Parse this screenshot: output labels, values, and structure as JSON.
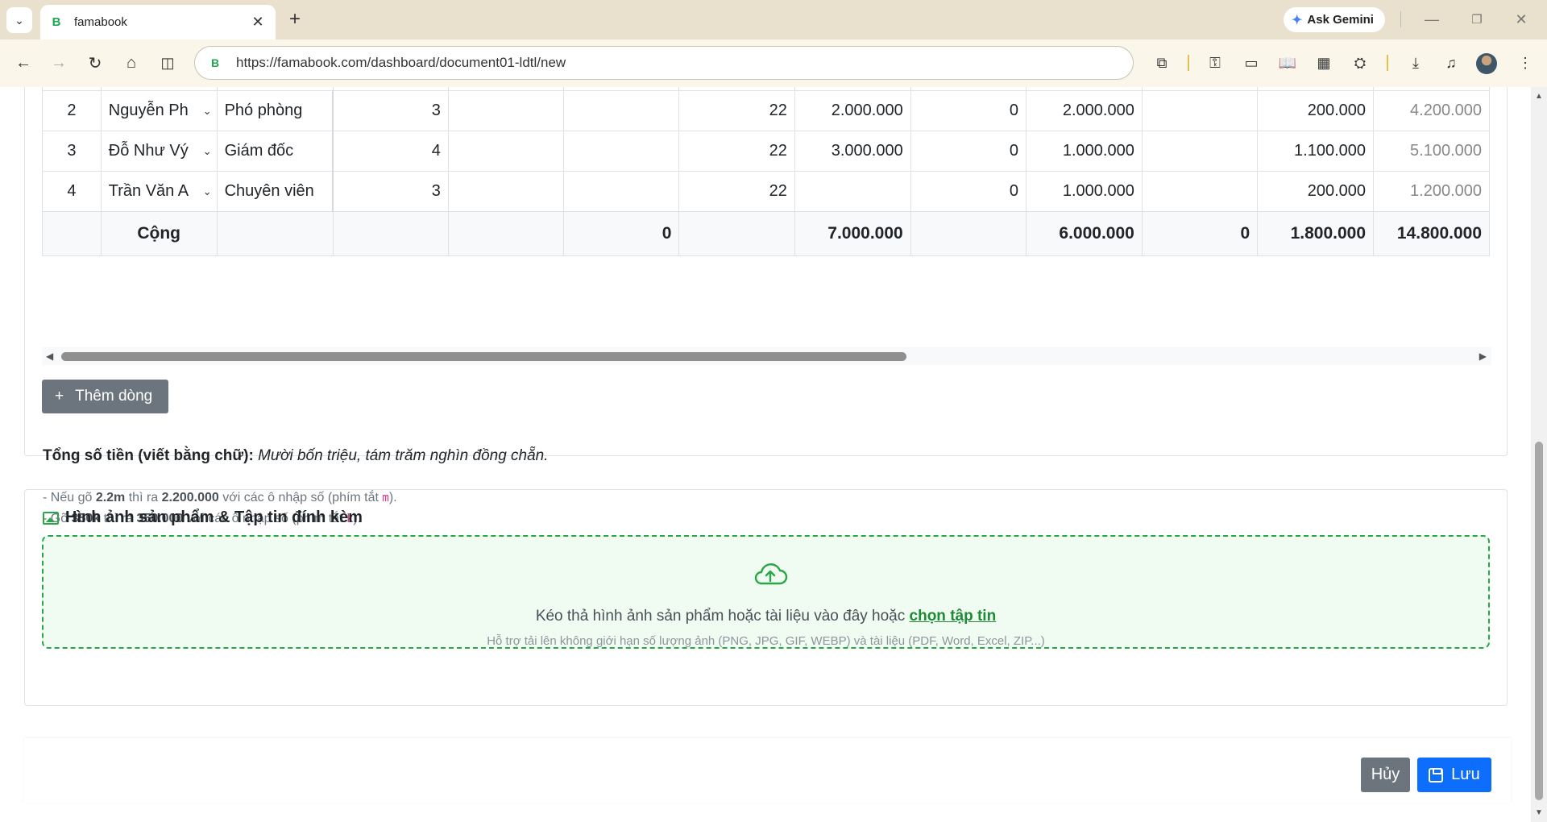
{
  "browser": {
    "tab_title": "famabook",
    "tab_favicon": "B",
    "url": "https://famabook.com/dashboard/document01-ldtl/new",
    "gemini_label": "Ask Gemini"
  },
  "table": {
    "rows": [
      {
        "stt": "2",
        "name": "Nguyễn Ph",
        "position": "Phó phòng",
        "coef": "3",
        "c5": "",
        "c6": "",
        "days": "22",
        "c8": "2.000.000",
        "c9": "0",
        "c10": "2.000.000",
        "c11": "",
        "c12": "200.000",
        "total": "4.200.000"
      },
      {
        "stt": "3",
        "name": "Đỗ Như Vý",
        "position": "Giám đốc",
        "coef": "4",
        "c5": "",
        "c6": "",
        "days": "22",
        "c8": "3.000.000",
        "c9": "0",
        "c10": "1.000.000",
        "c11": "",
        "c12": "1.100.000",
        "total": "5.100.000"
      },
      {
        "stt": "4",
        "name": "Trần Văn A",
        "position": "Chuyên viên",
        "coef": "3",
        "c5": "",
        "c6": "",
        "days": "22",
        "c8": "",
        "c9": "0",
        "c10": "1.000.000",
        "c11": "",
        "c12": "200.000",
        "total": "1.200.000"
      }
    ],
    "totals": {
      "label": "Cộng",
      "c6": "0",
      "c8": "7.000.000",
      "c10": "6.000.000",
      "c11": "0",
      "c12": "1.800.000",
      "total": "14.800.000"
    }
  },
  "add_row_label": "Thêm dòng",
  "amount_words": {
    "label": "Tổng số tiền (viết bằng chữ):",
    "value": "Mười bốn triệu, tám trăm nghìn đồng chẵn."
  },
  "hints": {
    "h1_prefix": "- Nếu gõ ",
    "h1_input": "2.2m",
    "h1_mid": " thì ra ",
    "h1_output": "2.200.000",
    "h1_suffix": " với các ô nhập số (phím tắt ",
    "h1_key": "m",
    "h1_end": ").",
    "h2_prefix": "- Gõ ",
    "h2_input": "350k",
    "h2_mid": " thì ra ",
    "h2_output": "350.000",
    "h2_suffix": " với các ô nhập số (phím tắt ",
    "h2_key": "k",
    "h2_end": ")."
  },
  "attachments": {
    "title": "Hình ảnh sản phẩm & Tập tin đính kèm",
    "drop_text": "Kéo thả hình ảnh sản phẩm hoặc tài liệu vào đây hoặc ",
    "drop_link": "chọn tập tin",
    "drop_sub": "Hỗ trợ tải lên không giới hạn số lượng ảnh (PNG, JPG, GIF, WEBP) và tài liệu (PDF, Word, Excel, ZIP...)"
  },
  "footer": {
    "cancel_label": "Hủy",
    "save_label": "Lưu"
  },
  "colors": {
    "primary": "#0d6efd",
    "secondary": "#6c757d",
    "success": "#28a745"
  }
}
